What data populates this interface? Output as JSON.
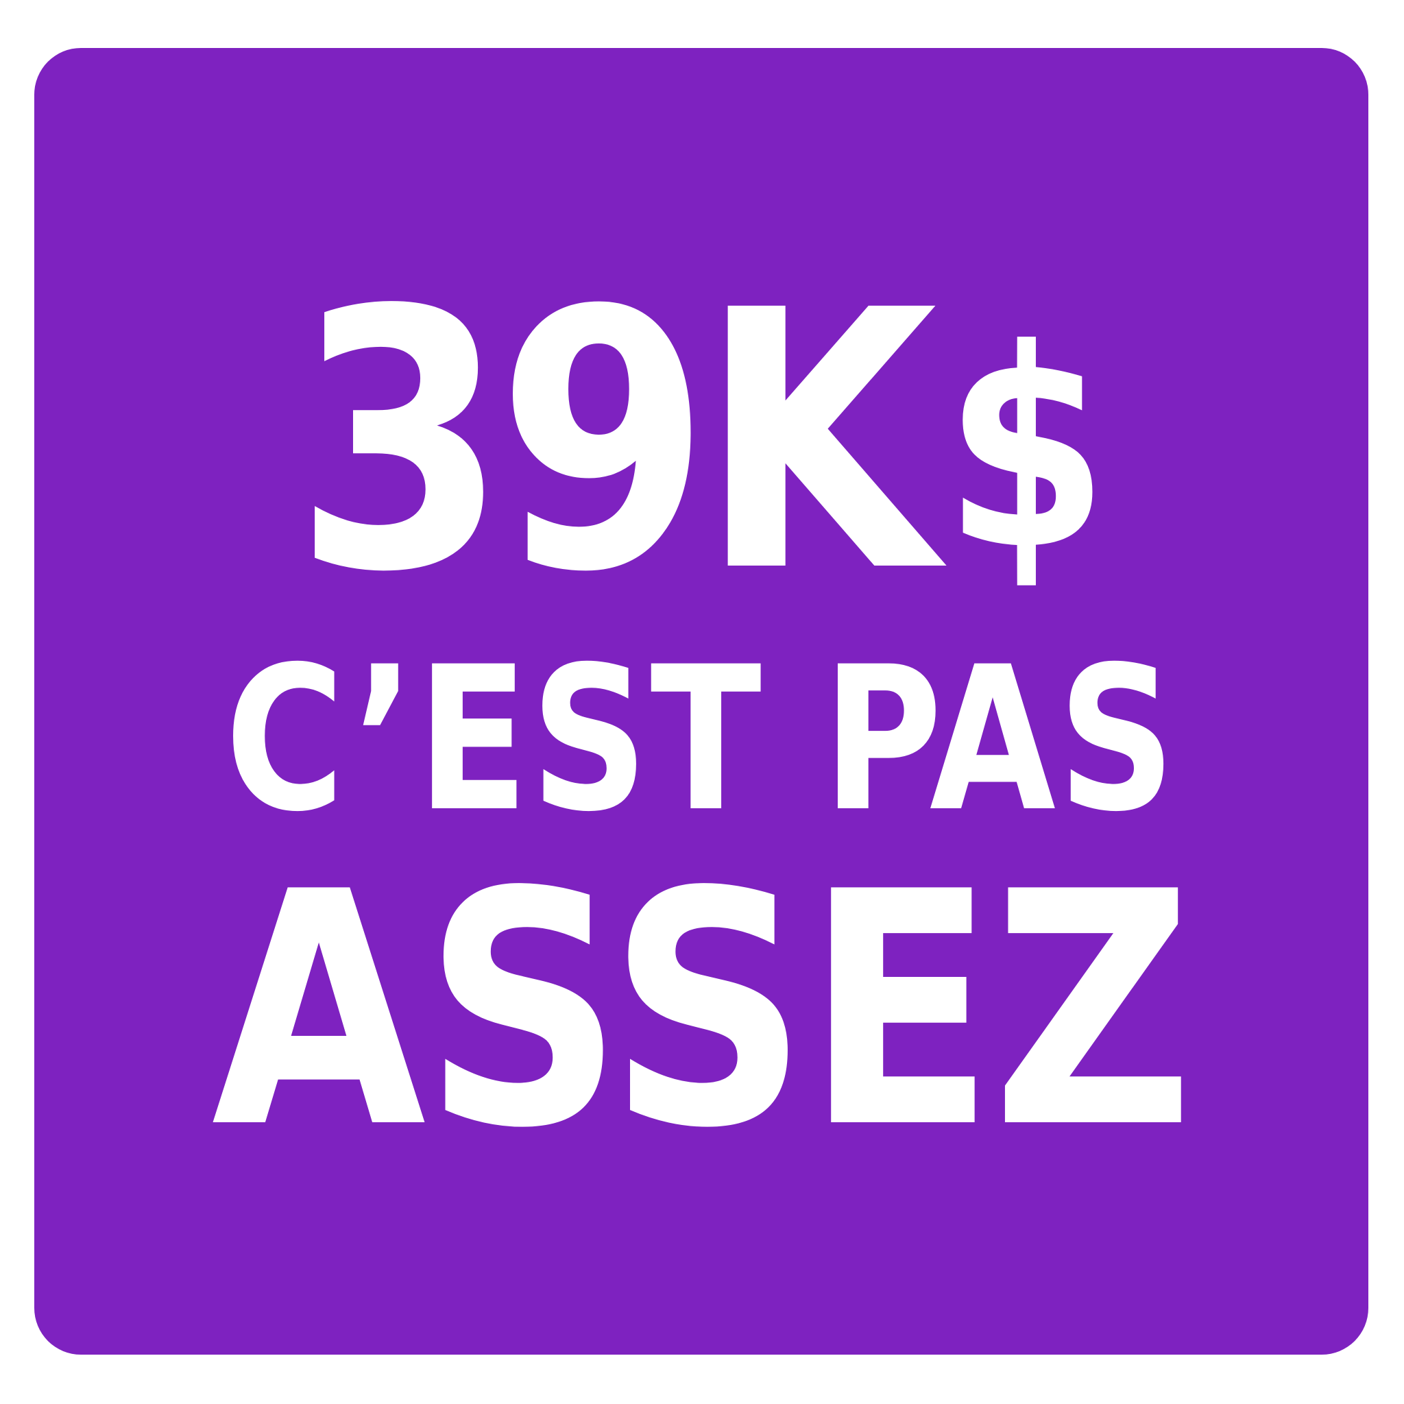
{
  "colors": {
    "background": "#ffffff",
    "panel": "#7e22c0",
    "text": "#ffffff"
  },
  "headline": {
    "amount": "39K",
    "currency": "$",
    "line2": "C’EST PAS",
    "line3": "ASSEZ"
  }
}
